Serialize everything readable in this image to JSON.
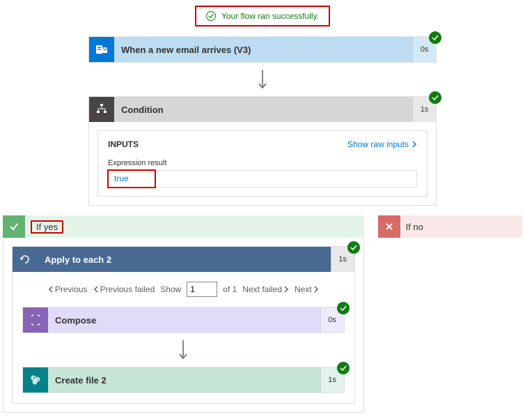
{
  "banner": {
    "message": "Your flow ran successfully."
  },
  "trigger": {
    "title": "When a new email arrives (V3)",
    "time": "0s"
  },
  "condition": {
    "title": "Condition",
    "time": "1s",
    "inputs_label": "INPUTS",
    "show_raw": "Show raw inputs",
    "expr_label": "Expression result",
    "expr_value": "true"
  },
  "branches": {
    "yes_label": "If yes",
    "no_label": "If no"
  },
  "apply_each": {
    "title": "Apply to each 2",
    "time": "1s",
    "pager": {
      "previous": "Previous",
      "previous_failed": "Previous failed",
      "show": "Show",
      "page_value": "1",
      "of_text": "of 1",
      "next_failed": "Next failed",
      "next": "Next"
    }
  },
  "compose": {
    "title": "Compose",
    "time": "0s"
  },
  "create_file": {
    "title": "Create file 2",
    "time": "1s"
  }
}
